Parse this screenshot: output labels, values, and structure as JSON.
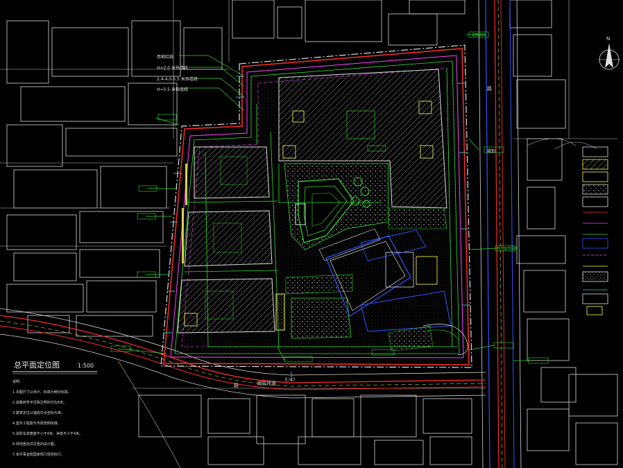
{
  "drawing": {
    "title": "总平面定位图",
    "scale": "1:500",
    "north_label": "N",
    "site_labels": {
      "ring_road": "消防环道",
      "south_road": "路",
      "east_road_a": "路",
      "east_road_b": "规划",
      "south_gate": "主入口"
    },
    "legend_callouts": [
      "用地红线",
      "H=2.0 米挡墙线",
      "2.4-4.0-5.5 米挡墙线",
      "H=5.5 米挡墙线",
      "建筑退线",
      "地下室范围线"
    ],
    "notes": [
      "说明：",
      "1.本图尺寸以米计，标高为绝对标高。",
      "2.道路转弯半径除注明外均为6米。",
      "3.建筑定位以轴线交点坐标为准。",
      "4.室外工程需与市政管网衔接。",
      "5.消防车道宽度不小于4米，净高不小于4米。",
      "6.场地竖向详见竖向设计图。",
      "7.未尽事宜按国家现行规范执行。"
    ]
  },
  "colors": {
    "background": "#000000",
    "red_line": "#ff2a2a",
    "wall_line": "#ff40ff",
    "green": "#33dd33",
    "cyan": "#22d3e0",
    "yellow": "#ffff55",
    "blue": "#3355ff",
    "white": "#e8e8e8"
  }
}
